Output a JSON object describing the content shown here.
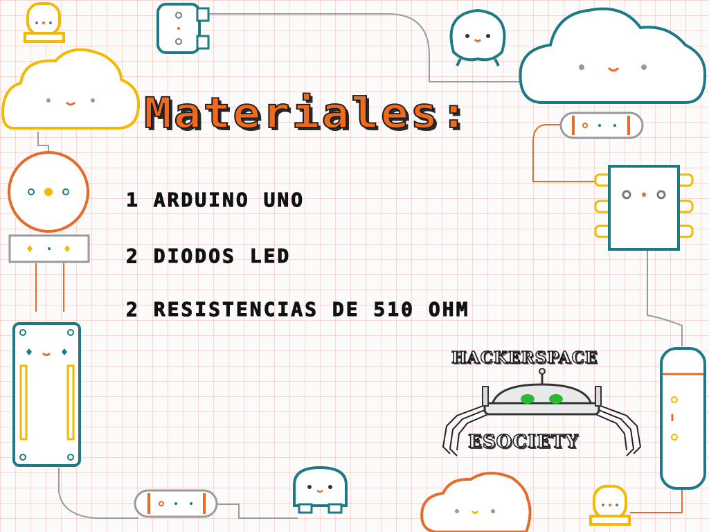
{
  "title": "Materiales:",
  "materials": [
    "1 Arduino Uno",
    "2 diodos led",
    "2 resistencias de 510 ohm"
  ],
  "logo": {
    "top_text": "HACKERSPACE",
    "bottom_text": "ESOCIETY"
  },
  "colors": {
    "orange": "#ef6a1c",
    "teal": "#1c7a86",
    "yellow": "#f5b800",
    "grid": "#e9a89a"
  },
  "icons": [
    "cloud-icon",
    "led-icon",
    "resistor-icon",
    "chip-icon",
    "arduino-board-icon",
    "robot-logo-icon",
    "battery-icon"
  ]
}
